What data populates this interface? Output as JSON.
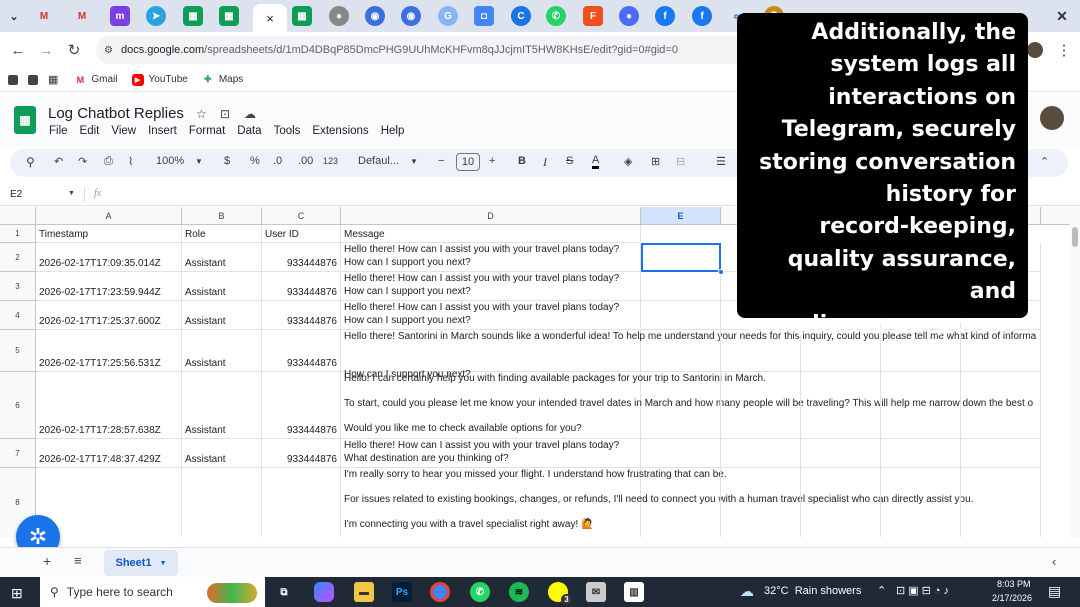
{
  "browser": {
    "url_host": "docs.google.com",
    "url_path": "/spreadsheets/d/1mD4DBqP85DmcPHG9UUhMcKHFvm8qJJcjmIT5HW8KHsE/edit?gid=0#gid=0",
    "active_tab_close": "×",
    "tab_icons": [
      "M",
      "M",
      "m",
      "telegram",
      "sheets",
      "sheets",
      "sheets",
      "circle",
      "chat",
      "chat",
      "g",
      "square",
      "C",
      "whatsapp",
      "figma",
      "circle",
      "facebook",
      "facebook",
      "meta",
      "badge"
    ],
    "bookmarks": [
      {
        "label": "Gmail",
        "icon": "gmail-icon"
      },
      {
        "label": "YouTube",
        "icon": "youtube-icon"
      },
      {
        "label": "Maps",
        "icon": "maps-icon"
      }
    ]
  },
  "sheet": {
    "title": "Log Chatbot Replies",
    "menu": [
      "File",
      "Edit",
      "View",
      "Insert",
      "Format",
      "Data",
      "Tools",
      "Extensions",
      "Help"
    ],
    "toolbar": {
      "zoom": "100%",
      "currency": "$",
      "percent": "%",
      "dec_decrease": ".0",
      "dec_increase": ".00",
      "number_format": "123",
      "font": "Defaul...",
      "font_size": "10",
      "bold": "B",
      "italic": "I"
    },
    "name_box": "E2",
    "fx": "fx",
    "columns": [
      "A",
      "B",
      "C",
      "D",
      "E",
      "F"
    ],
    "headers": {
      "timestamp": "Timestamp",
      "role": "Role",
      "user_id": "User ID",
      "message": "Message"
    },
    "rows": [
      {
        "num": "2",
        "timestamp": "2026-02-17T17:09:35.014Z",
        "role": "Assistant",
        "user_id": "933444876",
        "message": "Hello there! How can I assist you with your travel plans today?\nHow can I support you next?"
      },
      {
        "num": "3",
        "timestamp": "2026-02-17T17:23:59.944Z",
        "role": "Assistant",
        "user_id": "933444876",
        "message": "Hello there! How can I assist you with your travel plans today?\nHow can I support you next?"
      },
      {
        "num": "4",
        "timestamp": "2026-02-17T17:25:37.600Z",
        "role": "Assistant",
        "user_id": "933444876",
        "message": "Hello there! How can I assist you with your travel plans today?\nHow can I support you next?"
      },
      {
        "num": "5",
        "timestamp": "2026-02-17T17:25:56.531Z",
        "role": "Assistant",
        "user_id": "933444876",
        "message": "Hello there! Santorini in March sounds like a wonderful idea! To help me understand your needs for this inquiry, could you please tell me what kind of informa\n\n\nHow can I support you next?"
      },
      {
        "num": "6",
        "timestamp": "2026-02-17T17:28:57.638Z",
        "role": "Assistant",
        "user_id": "933444876",
        "message": "Hello! I can certainly help you with finding available packages for your trip to Santorini in March.\n\nTo start, could you please let me know your intended travel dates in March and how many people will be traveling? This will help me narrow down the best o\n\nWould you like me to check available options for you?"
      },
      {
        "num": "7",
        "timestamp": "2026-02-17T17:48:37.429Z",
        "role": "Assistant",
        "user_id": "933444876",
        "message": "Hello there! How can I assist you with your travel plans today?\nWhat destination are you thinking of?"
      },
      {
        "num": "8",
        "timestamp": "",
        "role": "",
        "user_id": "",
        "message": "I'm really sorry to hear you missed your flight. I understand how frustrating that can be.\n\nFor issues related to existing bookings, changes, or refunds, I'll need to connect you with a human travel specialist who can directly assist you.\n\nI'm connecting you with a travel specialist right away! 🙋"
      }
    ],
    "sheet_tab": "Sheet1"
  },
  "overlay_text": "Additionally, the\nsystem logs all\ninteractions on\nTelegram, securely\nstoring conversation\nhistory for\nrecord-keeping,\nquality assurance, and\ncompliance purposes.",
  "taskbar": {
    "search_placeholder": "Type here to search",
    "weather": "32°C  Rain showers",
    "time": "8:03 PM",
    "date": "2/17/2026",
    "badge": "3",
    "ps": "Ps"
  }
}
